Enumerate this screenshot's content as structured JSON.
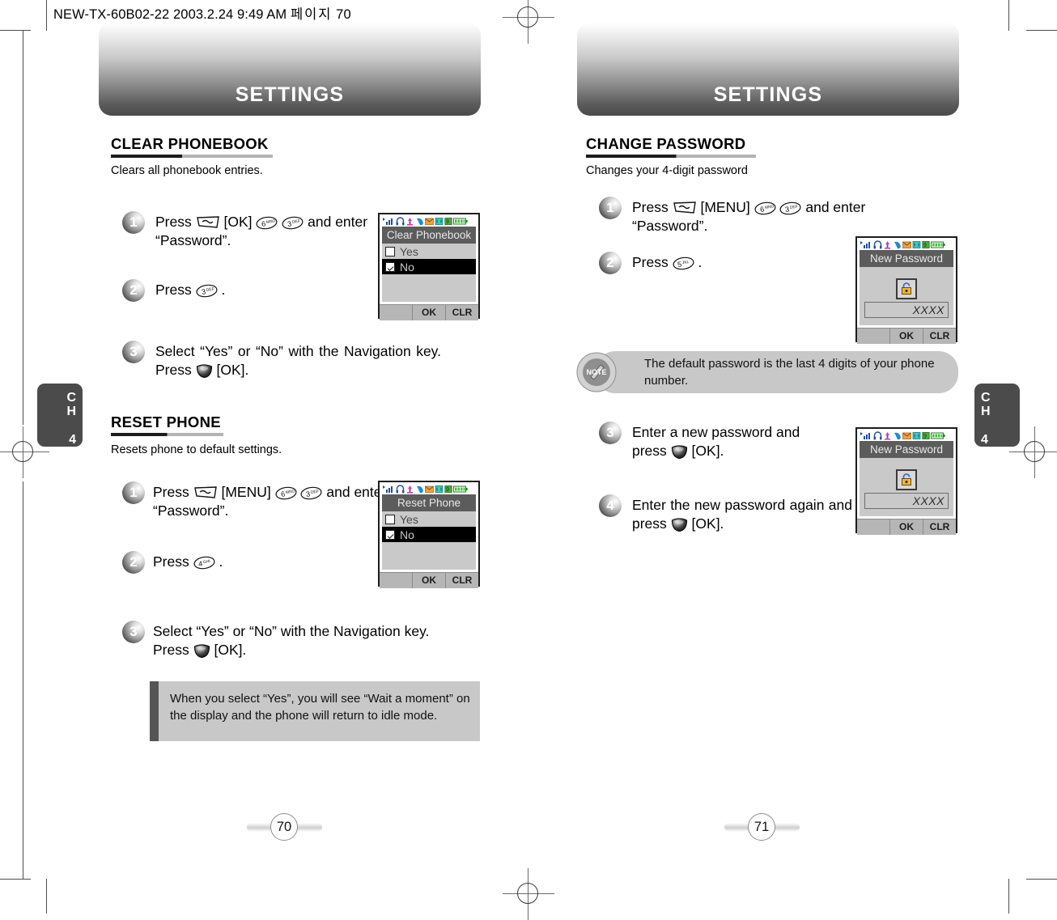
{
  "document": {
    "meta_line": "NEW-TX-60B02-22  2003.2.24 9:49 AM",
    "meta_cjk": "페이지",
    "meta_page": "70"
  },
  "chapter_tab": {
    "c": "C",
    "h": "H",
    "number": "4"
  },
  "left_page": {
    "banner_title": "SETTINGS",
    "page_number": "70",
    "sections": [
      {
        "heading": "CLEAR PHONEBOOK",
        "description": "Clears all phonebook entries.",
        "steps": [
          {
            "num": "1",
            "text_a": "Press",
            "key_soft": "softkey-icon",
            "text_b": "[OK]",
            "key_1": "6 MNO",
            "key_2": "3 DEF",
            "text_c": "and",
            "text_d": "enter “Password”."
          },
          {
            "num": "2",
            "text_a": "Press",
            "key_1": "3 DEF",
            "text_b": "."
          },
          {
            "num": "3",
            "text_a": "Select “Yes” or “No” with the Navigation key. Press",
            "text_b": "[OK]."
          }
        ],
        "phone": {
          "title": "Clear Phonebook",
          "options": [
            {
              "label": "Yes",
              "checked": false,
              "selected": false
            },
            {
              "label": "No",
              "checked": true,
              "selected": true
            }
          ],
          "softkeys": [
            "",
            "OK",
            "CLR"
          ]
        }
      },
      {
        "heading": "RESET PHONE",
        "description": "Resets phone to default settings.",
        "steps": [
          {
            "num": "1",
            "text_a": "Press",
            "key_soft": "softkey-icon",
            "text_b": "[MENU]",
            "key_1": "6 MNO",
            "key_2": "3 DEF",
            "text_c": "and",
            "text_d": "enter “Password”."
          },
          {
            "num": "2",
            "text_a": "Press",
            "key_1": "4 GHI",
            "text_b": "."
          },
          {
            "num": "3",
            "text_a": "Select “Yes” or “No” with the Navigation key.",
            "text_b": "Press",
            "text_c": "[OK]."
          }
        ],
        "phone": {
          "title": "Reset Phone",
          "options": [
            {
              "label": "Yes",
              "checked": false,
              "selected": false
            },
            {
              "label": "No",
              "checked": true,
              "selected": true
            }
          ],
          "softkeys": [
            "",
            "OK",
            "CLR"
          ]
        }
      }
    ],
    "info_box": "When you select “Yes”, you will see “Wait a moment” on the display and the phone will return to idle mode."
  },
  "right_page": {
    "banner_title": "SETTINGS",
    "page_number": "71",
    "sections": [
      {
        "heading": "CHANGE PASSWORD",
        "description": "Changes your 4-digit password",
        "steps": [
          {
            "num": "1",
            "text_a": "Press",
            "key_soft": "softkey-icon",
            "text_b": "[MENU]",
            "key_1": "6 MNO",
            "key_2": "3 DEF",
            "text_c": "and enter",
            "text_d": "“Password”."
          },
          {
            "num": "2",
            "text_a": "Press",
            "key_1": "5 JKL",
            "text_b": "."
          },
          {
            "num": "3",
            "text_a": "Enter a new password and",
            "text_b": "press",
            "text_c": "[OK]."
          },
          {
            "num": "4",
            "text_a": "Enter the new password again",
            "text_b": "and press",
            "text_c": "[OK]."
          }
        ]
      }
    ],
    "note": {
      "badge_label": "NOTE",
      "text": "The default password is the last 4 digits of your phone number."
    },
    "phones": [
      {
        "title": "New Password",
        "icon": "padlock-icon",
        "field_value": "XXXX",
        "softkeys": [
          "",
          "OK",
          "CLR"
        ]
      },
      {
        "title": "New Password",
        "icon": "padlock-icon",
        "field_value": "XXXX",
        "softkeys": [
          "",
          "OK",
          "CLR"
        ]
      }
    ]
  },
  "colors": {
    "banner_dark": "#4a4a4a",
    "tab_gray": "#4b4b4b",
    "panel_gray": "#c8c8c8",
    "screen_gray": "#c9c9c9",
    "title_bar": "#5c5c5c"
  }
}
